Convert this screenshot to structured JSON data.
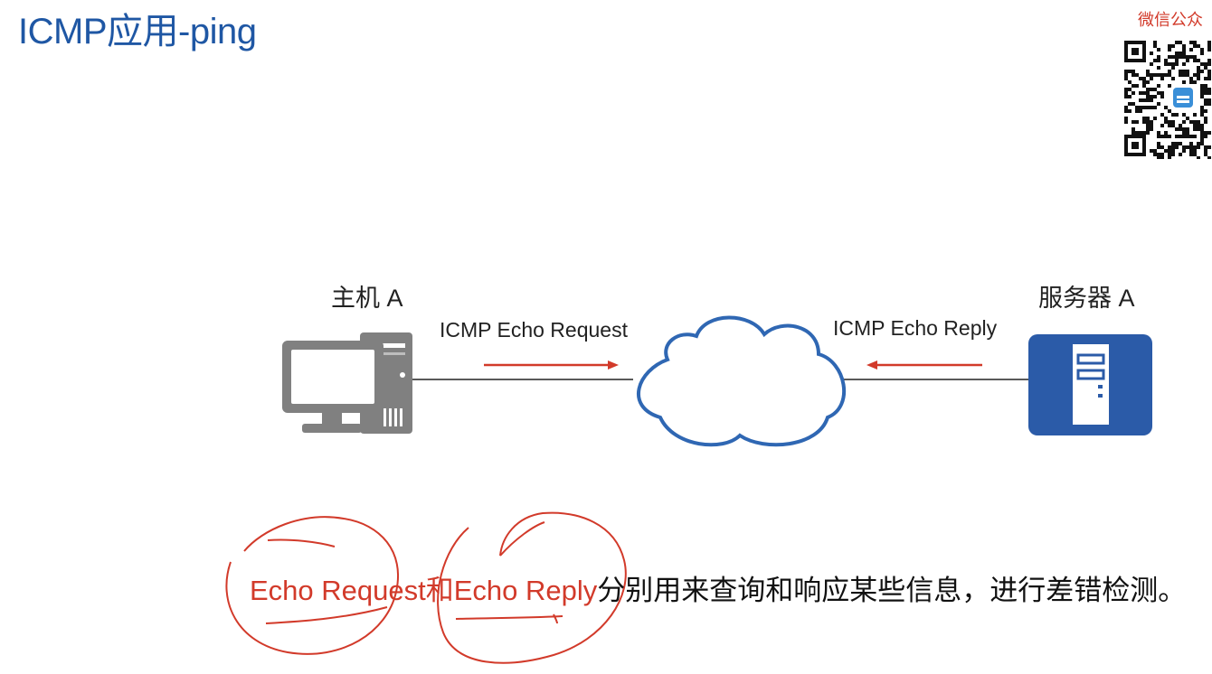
{
  "title": "ICMP应用-ping",
  "watermark": {
    "label": "微信公众",
    "icon": "qr-code-icon"
  },
  "diagram": {
    "host": {
      "label": "主机 A",
      "icon": "desktop-computer-icon"
    },
    "server": {
      "label": "服务器 A",
      "icon": "server-icon"
    },
    "network": {
      "icon": "cloud-icon"
    },
    "request": {
      "label": "ICMP Echo Request",
      "direction": "host-to-network"
    },
    "reply": {
      "label": "ICMP Echo Reply",
      "direction": "server-to-network"
    }
  },
  "description": {
    "part1": "Echo Request",
    "part2": "和",
    "part3": "Echo Reply",
    "part4": "分别用来查询和响应某些信息，进行差错检测。"
  },
  "colors": {
    "title": "#1f57a4",
    "accent_red": "#d23a2a",
    "cloud_stroke": "#2f67b3",
    "server_fill": "#2b5ba8",
    "computer_gray": "#808080"
  }
}
